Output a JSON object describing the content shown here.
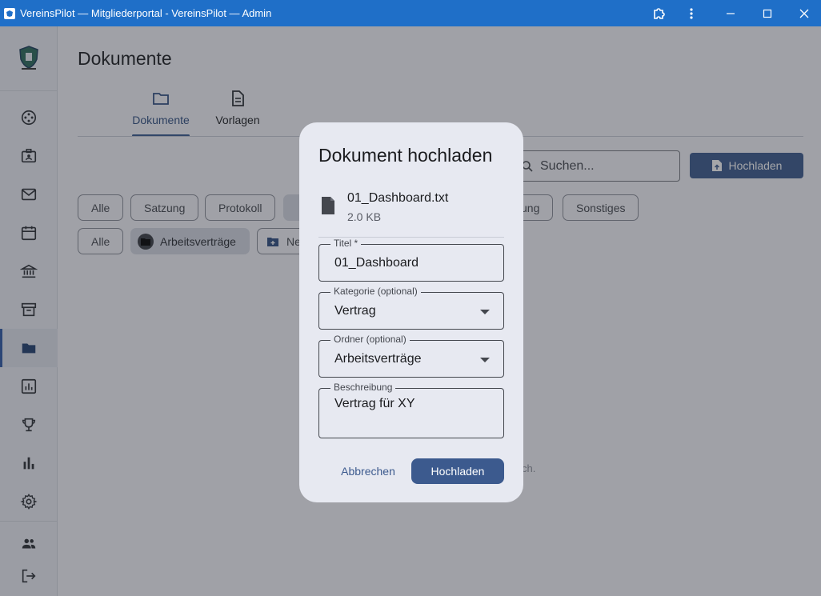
{
  "window": {
    "title": "VereinsPilot — Mitgliederportal - VereinsPilot — Admin"
  },
  "sidebar": {
    "items": [
      {
        "icon": "dashboard-icon"
      },
      {
        "icon": "members-id-icon"
      },
      {
        "icon": "mail-icon"
      },
      {
        "icon": "calendar-icon"
      },
      {
        "icon": "bank-icon"
      },
      {
        "icon": "archive-icon"
      },
      {
        "icon": "folder-icon",
        "active": true
      },
      {
        "icon": "report-icon"
      },
      {
        "icon": "trophy-icon"
      },
      {
        "icon": "bar-chart-icon"
      },
      {
        "icon": "settings-icon"
      }
    ],
    "bottom": [
      {
        "icon": "people-icon"
      },
      {
        "icon": "logout-icon"
      }
    ]
  },
  "page": {
    "title": "Dokumente",
    "tabs": [
      {
        "label": "Dokumente",
        "icon": "folder-icon",
        "active": true
      },
      {
        "label": "Vorlagen",
        "icon": "document-icon",
        "active": false
      }
    ],
    "search_placeholder": "Suchen...",
    "upload_label": "Hochladen",
    "category_chips": [
      "Alle",
      "Satzung",
      "Protokoll",
      "ung",
      "Sonstiges"
    ],
    "folder_chips": [
      "Alle",
      "Arbeitsverträge",
      "Ne"
    ],
    "empty_hint_fragment": "ch."
  },
  "dialog": {
    "title": "Dokument hochladen",
    "file": {
      "name": "01_Dashboard.txt",
      "size": "2.0 KB"
    },
    "fields": {
      "title": {
        "label": "Titel *",
        "value": "01_Dashboard"
      },
      "category": {
        "label": "Kategorie (optional)",
        "value": "Vertrag"
      },
      "folder": {
        "label": "Ordner (optional)",
        "value": "Arbeitsverträge"
      },
      "description": {
        "label": "Beschreibung",
        "value": "Vertrag für XY"
      }
    },
    "cancel_label": "Abbrechen",
    "submit_label": "Hochladen"
  },
  "colors": {
    "titlebar": "#1f6fc8",
    "accent": "#3c5a8e",
    "dialog_bg": "#e7e9f1"
  }
}
